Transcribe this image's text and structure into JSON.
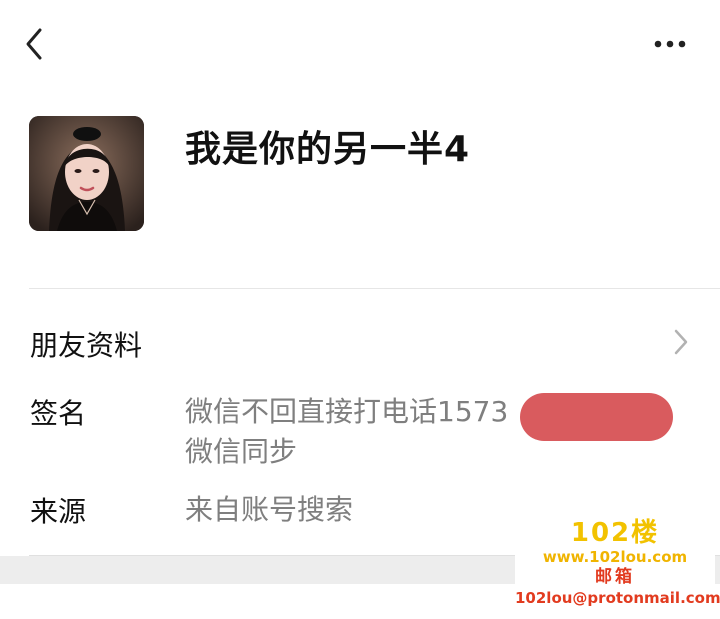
{
  "header": {
    "back_icon": "chevron-left-icon",
    "more_icon": "more-horizontal-icon"
  },
  "profile": {
    "nickname": "我是你的另一半4",
    "avatar_icon": "avatar-photo"
  },
  "friend_info": {
    "label": "朋友资料",
    "chevron_icon": "chevron-right-icon"
  },
  "signature": {
    "label": "签名",
    "line1": "微信不回直接打电话1573",
    "line2": "微信同步",
    "redaction_color": "#d95b5e"
  },
  "source": {
    "label": "来源",
    "value": "来自账号搜索"
  },
  "watermark": {
    "logo": "102楼",
    "site": "www.102lou.com",
    "mail_label": "邮箱",
    "email": "102lou@protonmail.com"
  }
}
